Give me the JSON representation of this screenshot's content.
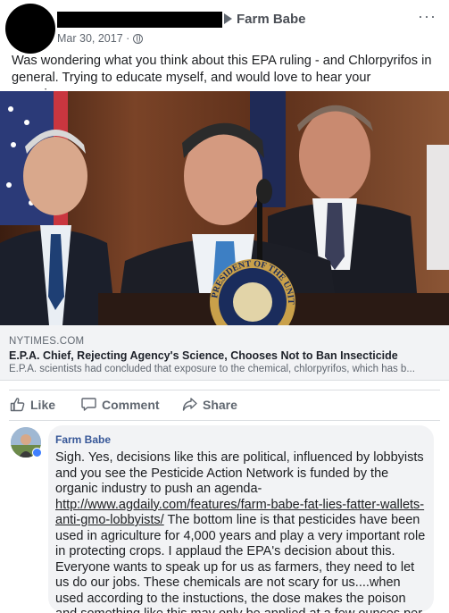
{
  "post": {
    "page_name": "Farm Babe",
    "date": "Mar 30, 2017 ·",
    "more_label": "···",
    "text": "Was wondering what you think about this EPA ruling - and Chlorpyrifos in general. Trying to educate myself, and would love to hear your experience."
  },
  "link_preview": {
    "domain": "NYTIMES.COM",
    "title": "E.P.A. Chief, Rejecting Agency's Science, Chooses Not to Ban Insecticide",
    "description": "E.P.A. scientists had concluded that exposure to the chemical, chlorpyrifos, which has b..."
  },
  "photo": {
    "seal_text": "PRESIDENT OF THE UNITED"
  },
  "actions": {
    "like": "Like",
    "comment": "Comment",
    "share": "Share"
  },
  "comment": {
    "author": "Farm Babe",
    "text_before": "Sigh. Yes, decisions like this are political, influenced by lobbyists and you see the Pesticide Action Network is funded by the organic industry to push an agenda- ",
    "link": "http://www.agdaily.com/features/farm-babe-fat-lies-fatter-wallets-anti-gmo-lobbyists/",
    "text_after": " The bottom line is that pesticides have been used in agriculture for 4,000 years and play a very important role in protecting crops. I applaud the EPA's decision about this. Everyone wants to speak up for us as farmers, they need to let us do our jobs. These chemicals are not scary for us....when used according to the instuctions, the dose makes the poison and something like this may only be applied at a few ounces per acre, hardly anything that could affect human health."
  },
  "colors": {
    "link_blue": "#385898",
    "muted": "#606770",
    "preview_bg": "#f2f3f5",
    "badge_blue": "#4080ff"
  }
}
